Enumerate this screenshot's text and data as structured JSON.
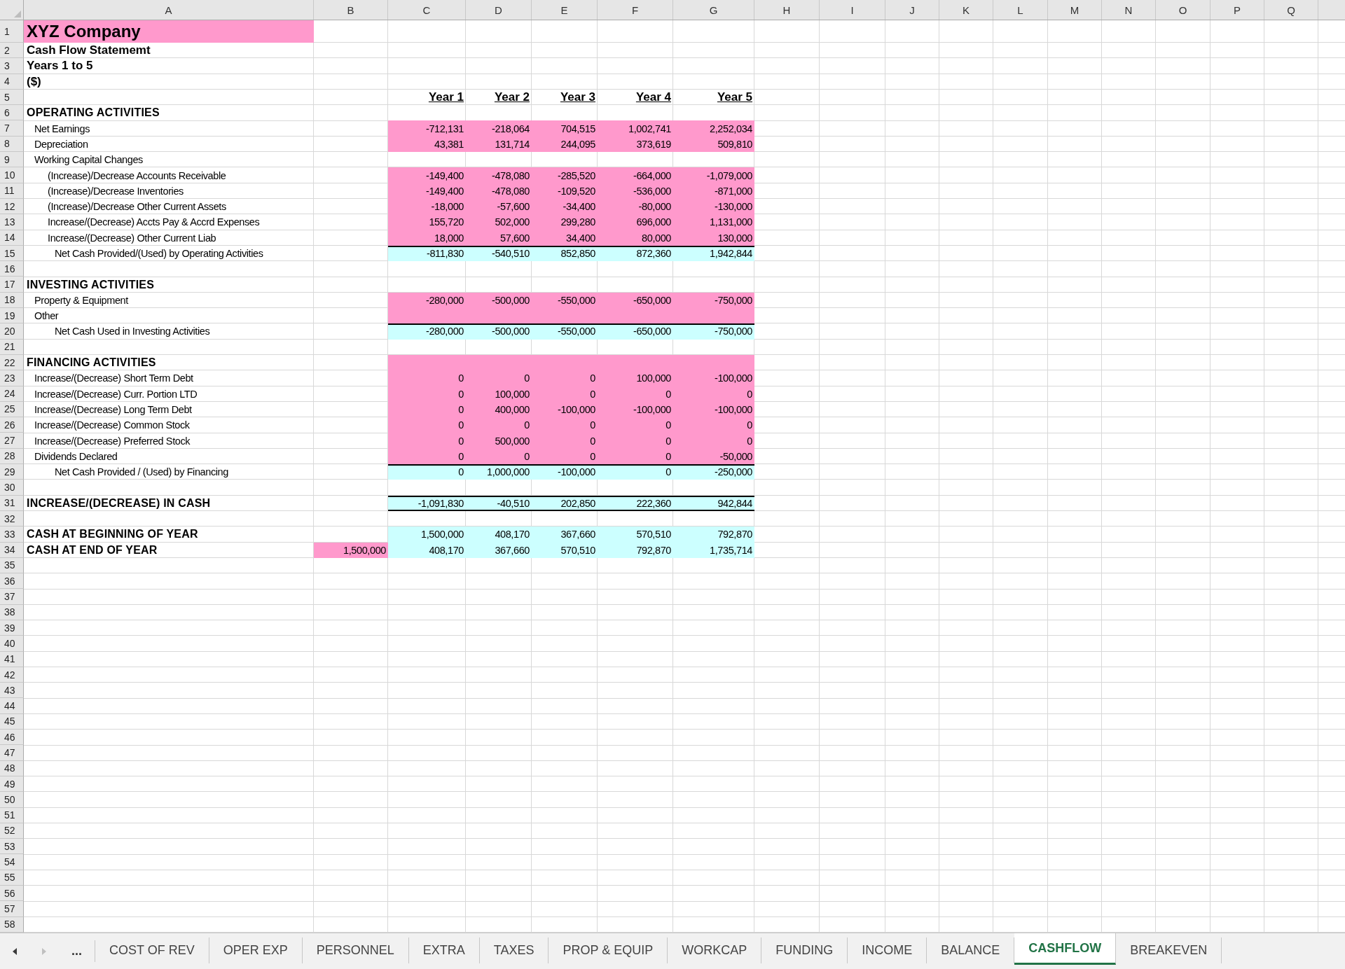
{
  "columns": [
    "A",
    "B",
    "C",
    "D",
    "E",
    "F",
    "G",
    "H",
    "I",
    "J",
    "K",
    "L",
    "M",
    "N",
    "O",
    "P",
    "Q"
  ],
  "rows": [
    {
      "number": "1",
      "label": {
        "kind": "title",
        "text": "XYZ Company"
      }
    },
    {
      "number": "2",
      "label": {
        "kind": "heading",
        "text": "Cash Flow Statememt"
      }
    },
    {
      "number": "3",
      "label": {
        "kind": "heading",
        "text": "Years 1 to 5"
      }
    },
    {
      "number": "4",
      "label": {
        "kind": "heading",
        "text": "($)"
      }
    },
    {
      "number": "5",
      "cells": {
        "kind": "header",
        "values": [
          "Year 1",
          "Year 2",
          "Year 3",
          "Year 4",
          "Year 5"
        ]
      }
    },
    {
      "number": "6",
      "label": {
        "kind": "section",
        "text": "OPERATING ACTIVITIES"
      }
    },
    {
      "number": "7",
      "label": {
        "kind": "item",
        "text": "Net Earnings"
      },
      "cells": {
        "kind": "input",
        "values": [
          "-712,131",
          "-218,064",
          "704,515",
          "1,002,741",
          "2,252,034"
        ]
      }
    },
    {
      "number": "8",
      "label": {
        "kind": "item",
        "text": "Depreciation"
      },
      "cells": {
        "kind": "input",
        "values": [
          "43,381",
          "131,714",
          "244,095",
          "373,619",
          "509,810"
        ]
      }
    },
    {
      "number": "9",
      "label": {
        "kind": "item",
        "text": "Working Capital Changes"
      }
    },
    {
      "number": "10",
      "label": {
        "kind": "subitem",
        "text": "(Increase)/Decrease Accounts Receivable"
      },
      "cells": {
        "kind": "input",
        "values": [
          "-149,400",
          "-478,080",
          "-285,520",
          "-664,000",
          "-1,079,000"
        ]
      }
    },
    {
      "number": "11",
      "label": {
        "kind": "subitem",
        "text": "(Increase)/Decrease Inventories"
      },
      "cells": {
        "kind": "input",
        "values": [
          "-149,400",
          "-478,080",
          "-109,520",
          "-536,000",
          "-871,000"
        ]
      }
    },
    {
      "number": "12",
      "label": {
        "kind": "subitem",
        "text": "(Increase)/Decrease Other Current Assets"
      },
      "cells": {
        "kind": "input",
        "values": [
          "-18,000",
          "-57,600",
          "-34,400",
          "-80,000",
          "-130,000"
        ]
      }
    },
    {
      "number": "13",
      "label": {
        "kind": "subitem",
        "text": "Increase/(Decrease) Accts Pay & Accrd Expenses"
      },
      "cells": {
        "kind": "input",
        "values": [
          "155,720",
          "502,000",
          "299,280",
          "696,000",
          "1,131,000"
        ]
      }
    },
    {
      "number": "14",
      "label": {
        "kind": "subitem",
        "text": "Increase/(Decrease) Other Current Liab"
      },
      "cells": {
        "kind": "input",
        "values": [
          "18,000",
          "57,600",
          "34,400",
          "80,000",
          "130,000"
        ]
      }
    },
    {
      "number": "15",
      "label": {
        "kind": "total",
        "text": "Net Cash Provided/(Used) by Operating Activities"
      },
      "cells": {
        "kind": "subtotal",
        "values": [
          "-811,830",
          "-540,510",
          "852,850",
          "872,360",
          "1,942,844"
        ]
      }
    },
    {
      "number": "16"
    },
    {
      "number": "17",
      "label": {
        "kind": "section",
        "text": "INVESTING ACTIVITIES"
      }
    },
    {
      "number": "18",
      "label": {
        "kind": "item",
        "text": "Property & Equipment"
      },
      "cells": {
        "kind": "input",
        "values": [
          "-280,000",
          "-500,000",
          "-550,000",
          "-650,000",
          "-750,000"
        ]
      }
    },
    {
      "number": "19",
      "label": {
        "kind": "item",
        "text": "Other"
      },
      "cells": {
        "kind": "input"
      }
    },
    {
      "number": "20",
      "label": {
        "kind": "total",
        "text": "Net Cash Used in Investing Activities"
      },
      "cells": {
        "kind": "subtotal",
        "values": [
          "-280,000",
          "-500,000",
          "-550,000",
          "-650,000",
          "-750,000"
        ]
      }
    },
    {
      "number": "21"
    },
    {
      "number": "22",
      "label": {
        "kind": "section",
        "text": "FINANCING ACTIVITIES"
      },
      "cells": {
        "kind": "input"
      }
    },
    {
      "number": "23",
      "label": {
        "kind": "item",
        "text": "Increase/(Decrease) Short Term Debt"
      },
      "cells": {
        "kind": "input",
        "values": [
          "0",
          "0",
          "0",
          "100,000",
          "-100,000"
        ]
      }
    },
    {
      "number": "24",
      "label": {
        "kind": "item",
        "text": "Increase/(Decrease) Curr. Portion LTD"
      },
      "cells": {
        "kind": "input",
        "values": [
          "0",
          "100,000",
          "0",
          "0",
          "0"
        ]
      }
    },
    {
      "number": "25",
      "label": {
        "kind": "item",
        "text": "Increase/(Decrease) Long Term Debt"
      },
      "cells": {
        "kind": "input",
        "values": [
          "0",
          "400,000",
          "-100,000",
          "-100,000",
          "-100,000"
        ]
      }
    },
    {
      "number": "26",
      "label": {
        "kind": "item",
        "text": "Increase/(Decrease) Common Stock"
      },
      "cells": {
        "kind": "input",
        "values": [
          "0",
          "0",
          "0",
          "0",
          "0"
        ]
      }
    },
    {
      "number": "27",
      "label": {
        "kind": "item",
        "text": "Increase/(Decrease) Preferred Stock"
      },
      "cells": {
        "kind": "input",
        "values": [
          "0",
          "500,000",
          "0",
          "0",
          "0"
        ]
      }
    },
    {
      "number": "28",
      "label": {
        "kind": "item",
        "text": "Dividends Declared"
      },
      "cells": {
        "kind": "input",
        "values": [
          "0",
          "0",
          "0",
          "0",
          "-50,000"
        ]
      }
    },
    {
      "number": "29",
      "label": {
        "kind": "total",
        "text": "Net Cash Provided / (Used) by Financing"
      },
      "cells": {
        "kind": "subtotal",
        "values": [
          "0",
          "1,000,000",
          "-100,000",
          "0",
          "-250,000"
        ]
      }
    },
    {
      "number": "30"
    },
    {
      "number": "31",
      "label": {
        "kind": "section",
        "text": "INCREASE/(DECREASE) IN CASH"
      },
      "cells": {
        "kind": "grand_total",
        "values": [
          "-1,091,830",
          "-40,510",
          "202,850",
          "222,360",
          "942,844"
        ]
      }
    },
    {
      "number": "32"
    },
    {
      "number": "33",
      "label": {
        "kind": "section",
        "text": "CASH AT BEGINNING OF YEAR"
      },
      "cells": {
        "kind": "balance",
        "values": [
          "1,500,000",
          "408,170",
          "367,660",
          "570,510",
          "792,870"
        ]
      }
    },
    {
      "number": "34",
      "label": {
        "kind": "section",
        "text": "CASH AT END OF YEAR"
      },
      "column_b": {
        "kind": "input",
        "text": "1,500,000"
      },
      "cells": {
        "kind": "balance",
        "values": [
          "408,170",
          "367,660",
          "570,510",
          "792,870",
          "1,735,714"
        ]
      }
    },
    {
      "number": "35"
    },
    {
      "number": "36"
    },
    {
      "number": "37"
    },
    {
      "number": "38"
    },
    {
      "number": "39"
    },
    {
      "number": "40"
    },
    {
      "number": "41"
    },
    {
      "number": "42"
    },
    {
      "number": "43"
    },
    {
      "number": "44"
    },
    {
      "number": "45"
    },
    {
      "number": "46"
    },
    {
      "number": "47"
    },
    {
      "number": "48"
    },
    {
      "number": "49"
    },
    {
      "number": "50"
    },
    {
      "number": "51"
    },
    {
      "number": "52"
    },
    {
      "number": "53"
    },
    {
      "number": "54"
    },
    {
      "number": "55"
    },
    {
      "number": "56"
    },
    {
      "number": "57"
    },
    {
      "number": "58"
    }
  ],
  "sheet_nav": [
    {
      "kind": "left",
      "disabled": false
    },
    {
      "kind": "right",
      "disabled": true
    }
  ],
  "more_sheets": "...",
  "tabs": [
    {
      "label": "COST OF REV",
      "selected": false
    },
    {
      "label": "OPER EXP",
      "selected": false
    },
    {
      "label": "PERSONNEL",
      "selected": false
    },
    {
      "label": "EXTRA",
      "selected": false
    },
    {
      "label": "TAXES",
      "selected": false
    },
    {
      "label": "PROP & EQUIP",
      "selected": false
    },
    {
      "label": "WORKCAP",
      "selected": false
    },
    {
      "label": "FUNDING",
      "selected": false
    },
    {
      "label": "INCOME",
      "selected": false
    },
    {
      "label": "BALANCE",
      "selected": false
    },
    {
      "label": "CASHFLOW",
      "selected": true
    },
    {
      "label": "BREAKEVEN",
      "selected": false
    }
  ]
}
